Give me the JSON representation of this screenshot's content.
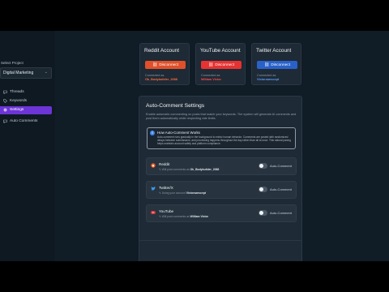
{
  "sidebar": {
    "project_label": "Select Project",
    "project_value": "Digital Marketing",
    "chevron": "⌄",
    "items": [
      {
        "label": "Threads",
        "icon": "threads-icon",
        "active": false
      },
      {
        "label": "Keywords",
        "icon": "tag-icon",
        "active": false
      },
      {
        "label": "Settings",
        "icon": "settings-icon",
        "active": true
      },
      {
        "label": "Auto Comments",
        "icon": "comment-icon",
        "active": false
      }
    ]
  },
  "accounts": [
    {
      "title": "Reddit Account",
      "button_label": "Disconnect",
      "button_color": "#e0502a",
      "connected_as_label": "Connected as",
      "username": "Ok_Bodybuilder_2088",
      "username_color": "#ff6a3d"
    },
    {
      "title": "YouTube Account",
      "button_label": "Disconnect",
      "button_color": "#e63232",
      "connected_as_label": "Connected as",
      "username": "William Victor",
      "username_color": "#ff4a4a"
    },
    {
      "title": "Twitter Account",
      "button_label": "Disconnect",
      "button_color": "#2a61c9",
      "connected_as_label": "Connected as",
      "username": "Victorsanscept",
      "username_color": "#5b9bff"
    }
  ],
  "auto_comment": {
    "title": "Auto-Comment Settings",
    "description": "Enable automatic commenting on posts that match your keywords. The system will generate AI comments and post them automatically while respecting rate limits.",
    "how_title": "How Auto-Comment Works",
    "how_text": "Auto-comment runs gradually in the background to mimic human behavior. Comments are posted with randomized delays between submissions, and processing happens throughout the day rather than all at once. This natural pacing helps maintain account safety and platform compliance.",
    "info_glyph": "i",
    "toggle_label": "Auto-Comment",
    "platforms": [
      {
        "name": "Reddit",
        "sub_prefix": "Will post comments as",
        "username": "Ok_Bodybuilder_2088",
        "icon": "reddit-icon",
        "icon_color": "#ff5a1f",
        "enabled": false
      },
      {
        "name": "Twitter/X",
        "sub_prefix": "Using your account",
        "username": "Victorsanscept",
        "icon": "twitter-icon",
        "icon_color": "#3b9cf0",
        "enabled": false
      },
      {
        "name": "YouTube",
        "sub_prefix": "Will post comments as",
        "username": "William Victor",
        "icon": "youtube-icon",
        "icon_color": "#ff3b3b",
        "enabled": false
      }
    ]
  }
}
